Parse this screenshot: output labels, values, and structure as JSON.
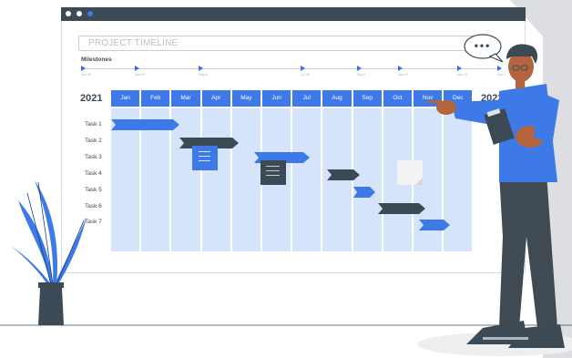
{
  "title": "PROJECT TIMELINE",
  "milestones": {
    "label": "Milestones",
    "dates": [
      "Jun 25",
      "Mar 29",
      "May 9",
      "Jul 26",
      "Sep 2",
      "Sep 27",
      "Nov 19",
      "Dec 1"
    ]
  },
  "years": {
    "start": "2021",
    "end": "2022"
  },
  "months": [
    "Jan",
    "Feb",
    "Mar",
    "Apr",
    "May",
    "Jun",
    "Jul",
    "Aug",
    "Sep",
    "Oct",
    "Nov",
    "Dec"
  ],
  "tasks": [
    "Task 1",
    "Task 2",
    "Task 3",
    "Task 4",
    "Task 5",
    "Task 6",
    "Task 7"
  ],
  "speech_bubble": "•••",
  "colors": {
    "accent": "#3d7ae8",
    "dark": "#3c4a56",
    "column_fill": "#d6e4fb",
    "skin": "#b5653d",
    "shirt": "#3d7ae8",
    "pants": "#3f4a52"
  }
}
